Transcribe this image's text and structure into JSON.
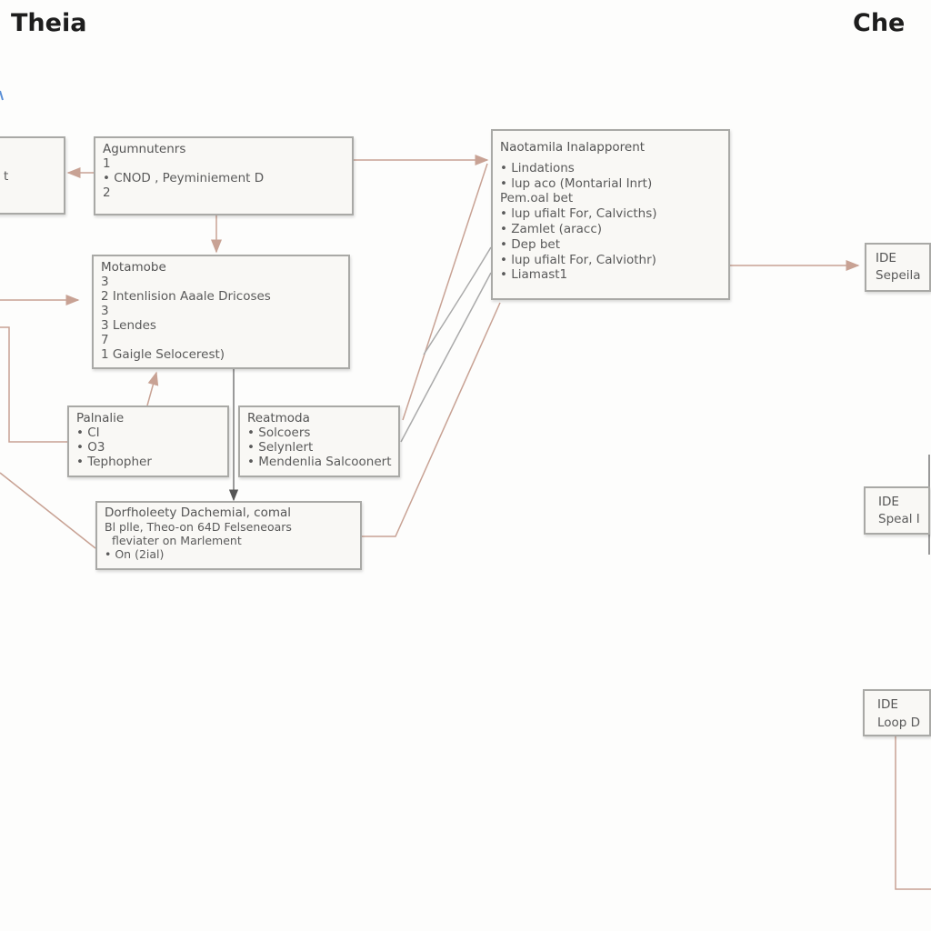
{
  "titles": {
    "left": "Theia",
    "right": "Che"
  },
  "colors": {
    "connector": "#c8a294",
    "border": "#a9a9a6",
    "dark_connector": "#666666"
  },
  "boxes": {
    "left_partial": {
      "lines": [
        "t"
      ]
    },
    "agum": {
      "title": "Agumnutenrs",
      "lines": [
        "1",
        "• CNOD , Peyminiement D",
        "2"
      ]
    },
    "motamobe": {
      "title": "Motamobe",
      "lines": [
        "3",
        "2 Intenlision Aaale Dricoses",
        "3",
        "3 Lendes",
        "7",
        "1 Gaigle Selocerest)"
      ]
    },
    "palnalie": {
      "title": "Palnalie",
      "lines": [
        "• CI",
        "• O3",
        "• Tephopher"
      ]
    },
    "reatmoda": {
      "title": "Reatmoda",
      "lines": [
        "• Solcoers",
        "• Selynlert",
        "• Mendenlia Salcoonert"
      ]
    },
    "dorfholeety": {
      "title": "Dorfholeety Dachemial, comal",
      "lines": [
        "Bl plle, Theo-on 64D Felseneoars",
        "  fleviater on Marlement",
        "• On (2ial)"
      ]
    },
    "naotamila": {
      "title": "Naotamila Inalapporent",
      "lines": [
        "",
        "• Lindations",
        "• lup aco (Montarial Inrt)",
        "Pem.oal bet",
        "• lup ufialt For, Calvicths)",
        "• Zamlet (aracc)",
        "• Dep bet",
        "• lup ufialt For, Calviothr)",
        "• Liamast1"
      ]
    },
    "ide1": {
      "title": "IDE",
      "lines": [
        "Sepeila"
      ]
    },
    "ide2": {
      "title": "IDE",
      "lines": [
        "Speal I"
      ]
    },
    "ide3": {
      "title": "IDE",
      "lines": [
        "Loop D"
      ]
    }
  }
}
